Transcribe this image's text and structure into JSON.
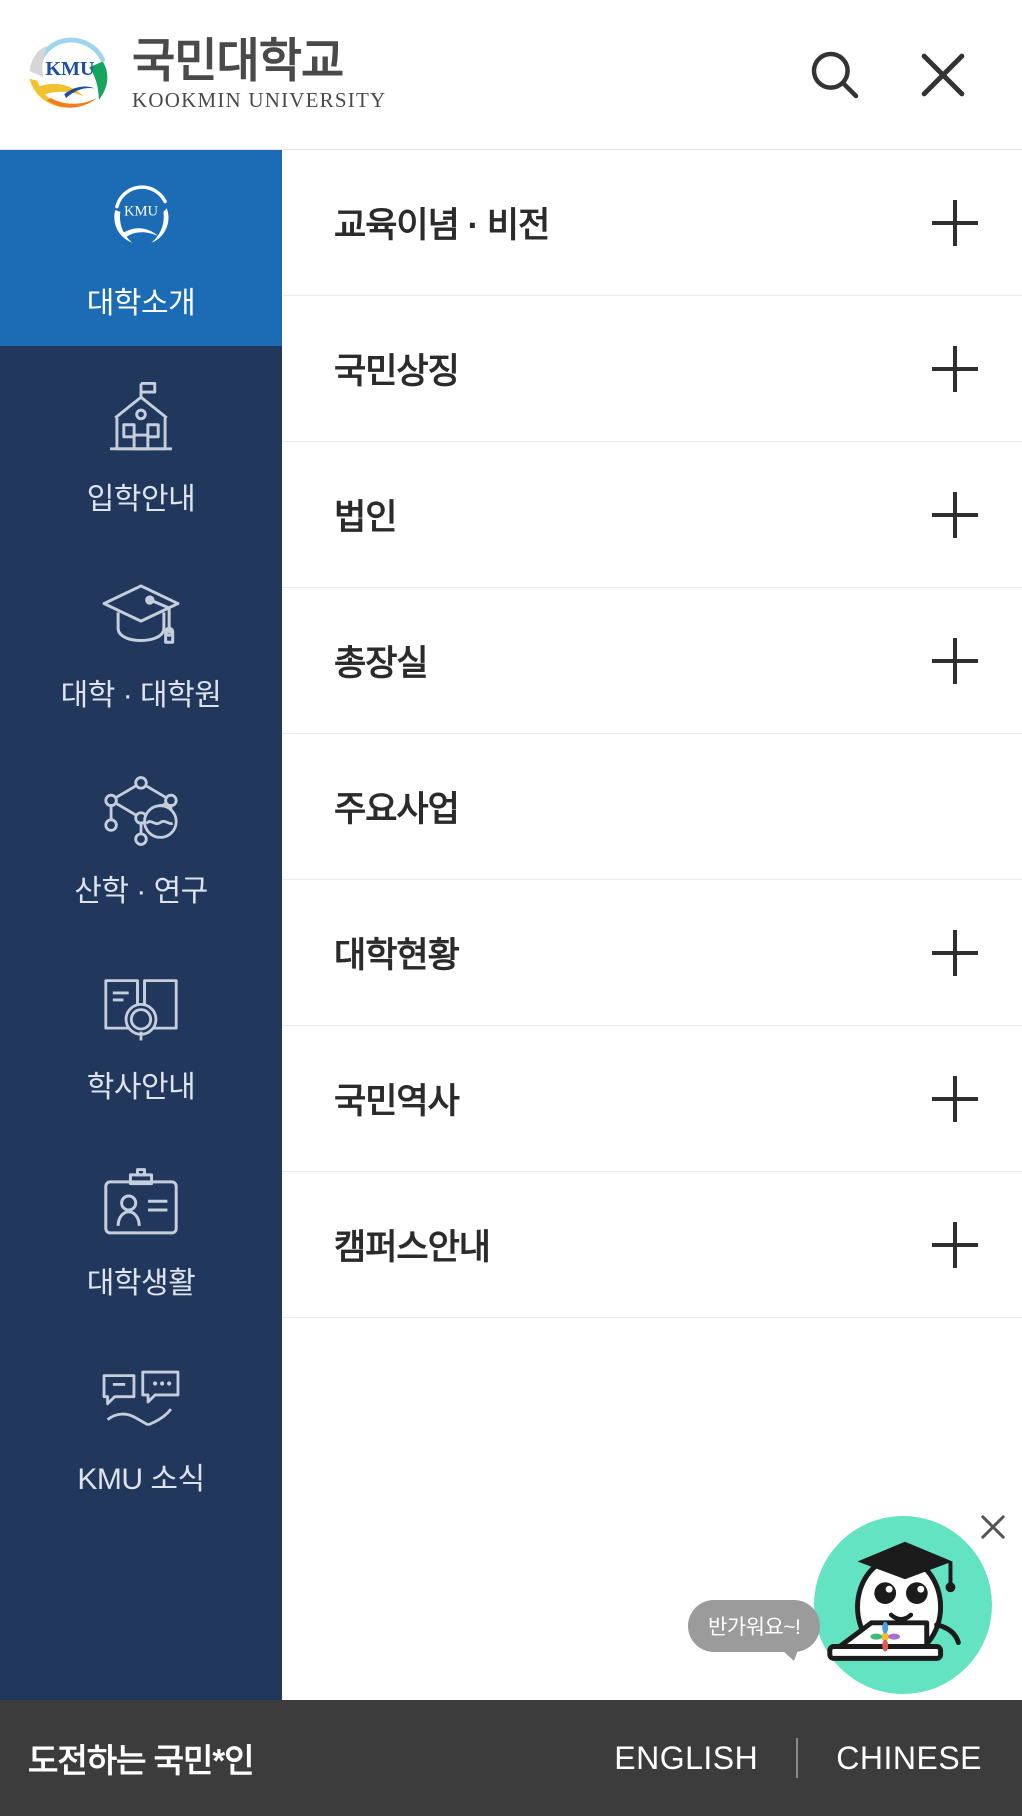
{
  "header": {
    "brand_kr": "국민대학교",
    "brand_en": "KOOKMIN UNIVERSITY",
    "logo_mark": "KMU",
    "search_icon": "search-icon",
    "close_icon": "close-icon"
  },
  "sidebar": {
    "items": [
      {
        "label": "대학소개",
        "icon": "kmu-emblem-icon",
        "active": true
      },
      {
        "label": "입학안내",
        "icon": "school-building-icon",
        "active": false
      },
      {
        "label": "대학 · 대학원",
        "icon": "graduation-cap-icon",
        "active": false
      },
      {
        "label": "산학 · 연구",
        "icon": "network-research-icon",
        "active": false
      },
      {
        "label": "학사안내",
        "icon": "open-book-search-icon",
        "active": false
      },
      {
        "label": "대학생활",
        "icon": "id-badge-icon",
        "active": false
      },
      {
        "label": "KMU 소식",
        "icon": "speech-bubble-hand-icon",
        "active": false
      }
    ]
  },
  "menu": {
    "rows": [
      {
        "label": "교육이념 · 비전",
        "has_expander": true
      },
      {
        "label": "국민상징",
        "has_expander": true
      },
      {
        "label": "법인",
        "has_expander": true
      },
      {
        "label": "총장실",
        "has_expander": true
      },
      {
        "label": "주요사업",
        "has_expander": false
      },
      {
        "label": "대학현황",
        "has_expander": true
      },
      {
        "label": "국민역사",
        "has_expander": true
      },
      {
        "label": "캠퍼스안내",
        "has_expander": true
      }
    ],
    "expander_icon": "plus-icon"
  },
  "chatbot": {
    "bubble_text": "반가워요~!",
    "character": "graduate-mascot-with-laptop",
    "close_icon": "close-icon"
  },
  "footer": {
    "slogan": "도전하는 국민*인",
    "lang_english": "ENGLISH",
    "lang_chinese": "CHINESE"
  },
  "colors": {
    "sidebar_bg": "#22375c",
    "sidebar_active": "#1b6cb5",
    "footer_bg": "#3c3c3c",
    "chatbot_accent": "#63e3c2",
    "text_dark": "#2b2b2b"
  }
}
